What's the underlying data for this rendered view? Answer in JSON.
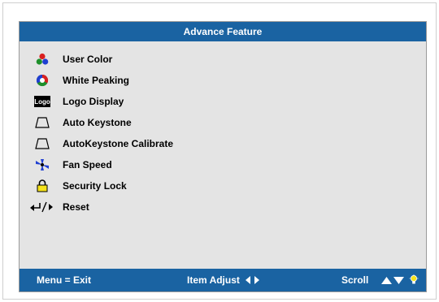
{
  "panel": {
    "title": "Advance Feature"
  },
  "menu": {
    "items": [
      {
        "label": "User Color",
        "icon": "user-color-icon"
      },
      {
        "label": "White Peaking",
        "icon": "white-peaking-icon"
      },
      {
        "label": "Logo Display",
        "icon": "logo-icon",
        "icon_text": "Logo"
      },
      {
        "label": "Auto Keystone",
        "icon": "keystone-icon"
      },
      {
        "label": "AutoKeystone Calibrate",
        "icon": "keystone-calibrate-icon"
      },
      {
        "label": "Fan Speed",
        "icon": "fan-icon"
      },
      {
        "label": "Security Lock",
        "icon": "lock-icon"
      },
      {
        "label": "Reset",
        "icon": "reset-icon"
      }
    ]
  },
  "footer": {
    "menu_exit": "Menu = Exit",
    "item_adjust": "Item Adjust",
    "scroll": "Scroll"
  },
  "colors": {
    "bar_blue": "#1a63a2",
    "panel_gray": "#e4e4e4",
    "lock_yellow": "#f5e21b"
  }
}
